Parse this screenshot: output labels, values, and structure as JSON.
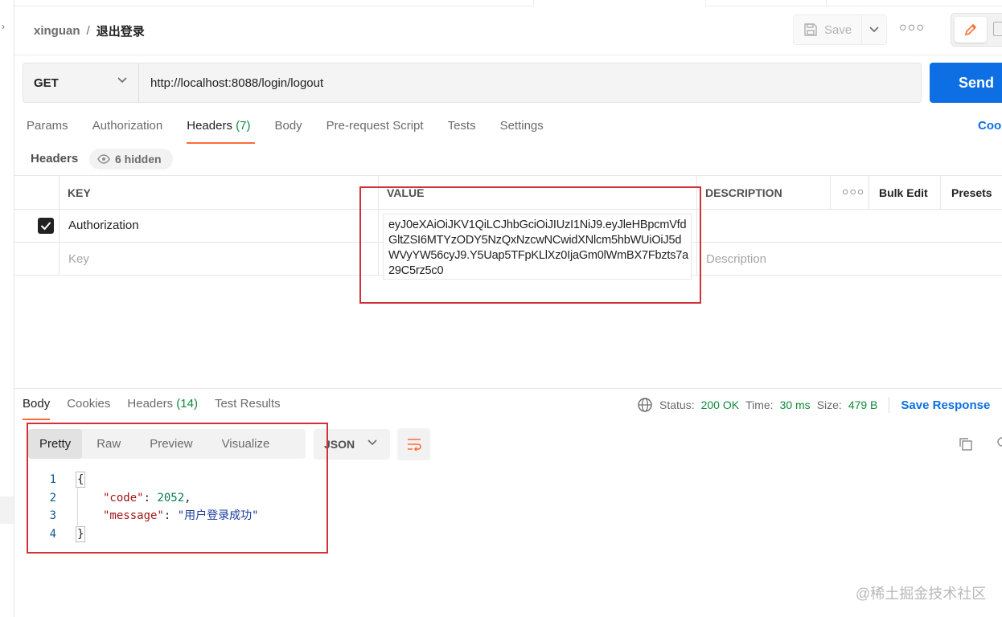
{
  "breadcrumb": {
    "workspace": "xinguan",
    "separator": "/",
    "request_name": "退出登录"
  },
  "toolbar": {
    "save_label": "Save"
  },
  "request": {
    "method": "GET",
    "url": "http://localhost:8088/login/logout",
    "send_label": "Send"
  },
  "request_tabs": {
    "params": "Params",
    "authorization": "Authorization",
    "headers": "Headers",
    "headers_count": "(7)",
    "body": "Body",
    "prerequest": "Pre-request Script",
    "tests": "Tests",
    "settings": "Settings",
    "cookies": "Coo"
  },
  "headers_section": {
    "label": "Headers",
    "hidden": "6 hidden"
  },
  "headers_table": {
    "columns": {
      "key": "KEY",
      "value": "VALUE",
      "description": "DESCRIPTION",
      "bulk_edit": "Bulk Edit",
      "presets": "Presets"
    },
    "rows": [
      {
        "key": "Authorization",
        "value": "eyJ0eXAiOiJKV1QiLCJhbGciOiJIUzI1NiJ9.eyJleHBpcmVfdGltZSI6MTYzODY5NzQxNzcwNCwidXNlcm5hbWUiOiJ5dWVyYW56cyJ9.Y5Uap5TFpKLlXz0IjaGm0lWmBX7Fbzts7a29C5rz5c0",
        "checked": true
      }
    ],
    "placeholder_key": "Key",
    "placeholder_description": "Description"
  },
  "response_tabs": {
    "body": "Body",
    "cookies": "Cookies",
    "headers": "Headers",
    "headers_count": "(14)",
    "test_results": "Test Results"
  },
  "response_status": {
    "status_label": "Status:",
    "status_value": "200 OK",
    "time_label": "Time:",
    "time_value": "30 ms",
    "size_label": "Size:",
    "size_value": "479 B",
    "save_response": "Save Response"
  },
  "response_view": {
    "modes": [
      "Pretty",
      "Raw",
      "Preview",
      "Visualize"
    ],
    "format": "JSON"
  },
  "response_body": {
    "line_numbers": [
      "1",
      "2",
      "3",
      "4"
    ],
    "open_brace": "{",
    "code_key": "\"code\"",
    "code_value": "2052",
    "message_key": "\"message\"",
    "message_value": "\"用户登录成功\"",
    "close_brace": "}"
  },
  "watermark": "@稀土掘金技术社区",
  "colors": {
    "accent_orange": "#ff6c37",
    "send_blue": "#0d6fe3",
    "status_green": "#0f8a3c",
    "annotation_red": "#d0313a"
  }
}
